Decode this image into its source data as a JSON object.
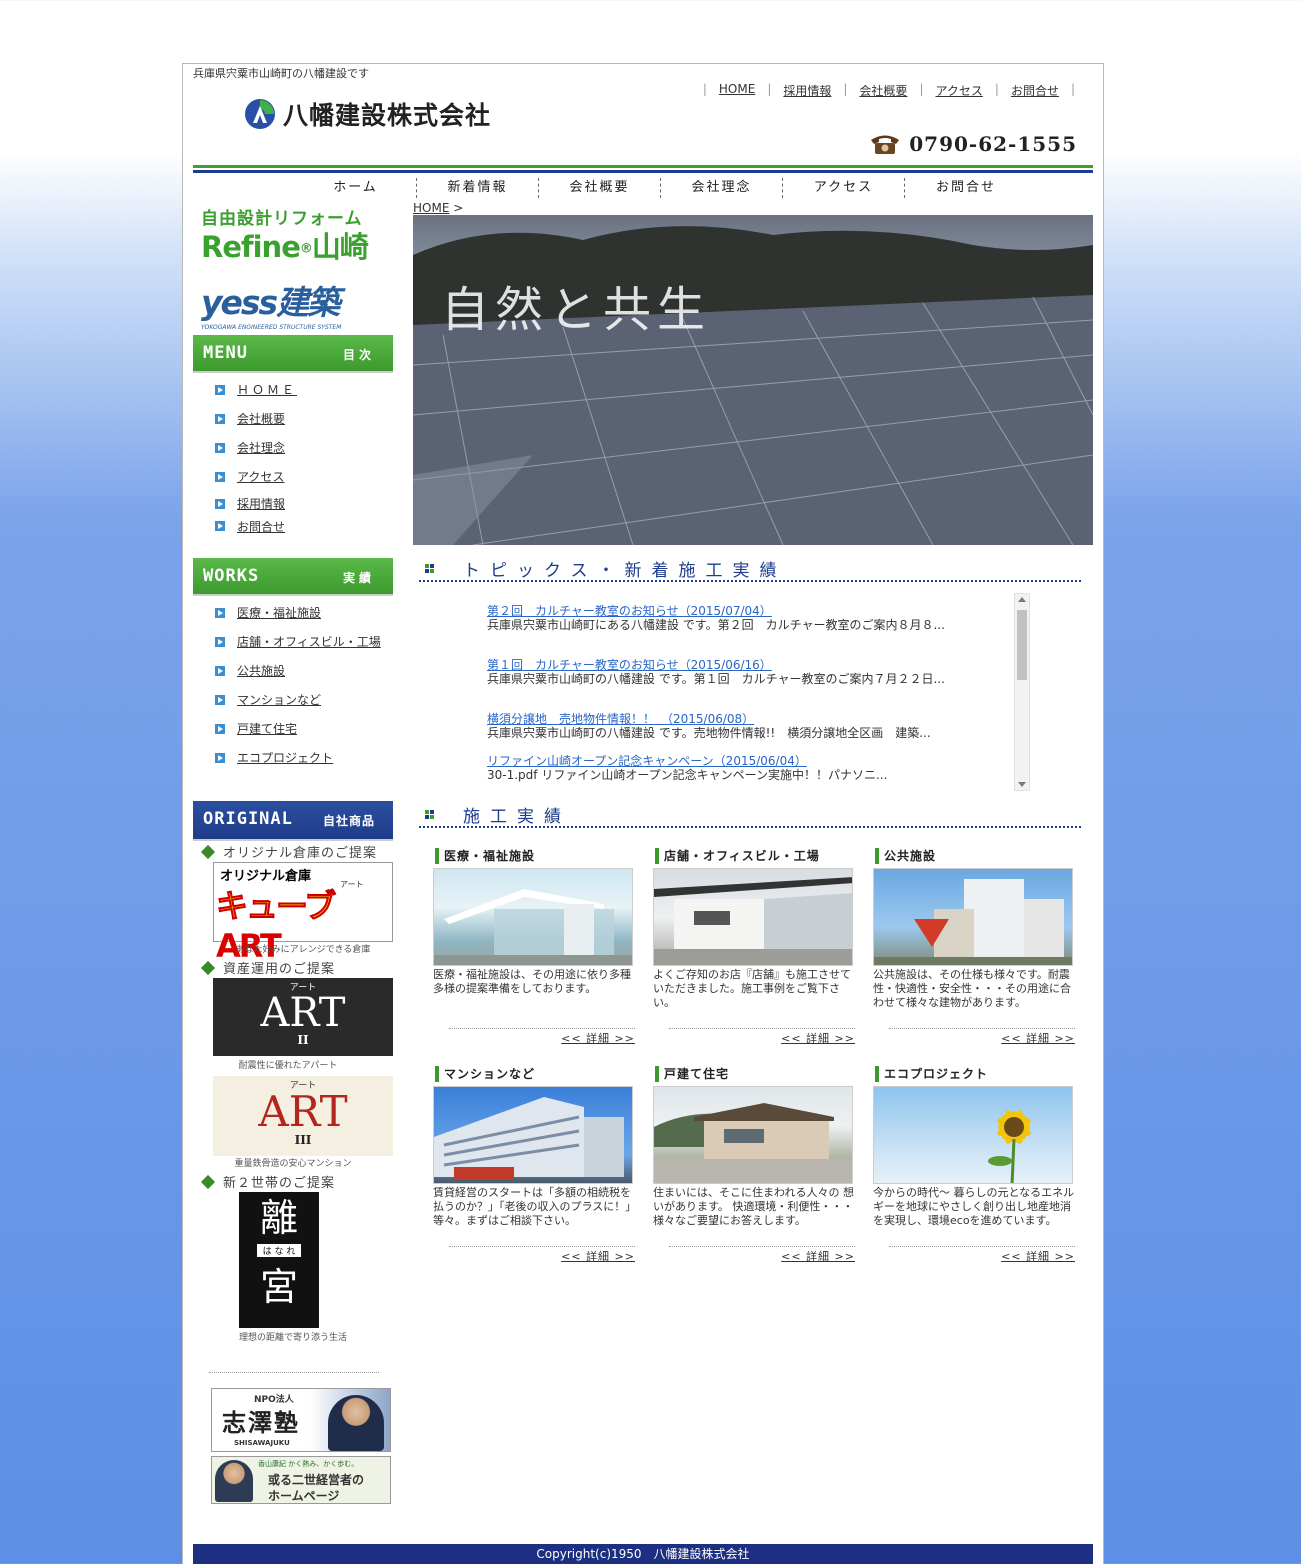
{
  "header": {
    "tagline": "兵庫県宍粟市山崎町の八幡建設です",
    "company_name": "八幡建設株式会社",
    "phone": "0790-62-1555",
    "top_links": [
      "HOME",
      "採用情報",
      "会社概要",
      "アクセス",
      "お問合せ"
    ]
  },
  "global_nav": [
    "ホーム",
    "新着情報",
    "会社概要",
    "会社理念",
    "アクセス",
    "お問合せ"
  ],
  "sidebar": {
    "refine_banner": {
      "line1": "自由設計リフォーム",
      "line2": "Refine",
      "line2b": "山崎"
    },
    "yess_banner": {
      "title": "yess建築",
      "sub": "YOKOGAWA ENGINEERED STRUCTURE SYSTEM"
    },
    "menu": {
      "title_en": "MENU",
      "title_jp": "目次",
      "items": [
        "ＨＯＭＥ",
        "会社概要",
        "会社理念",
        "アクセス",
        "採用情報",
        "お問合せ"
      ]
    },
    "works": {
      "title_en": "WORKS",
      "title_jp": "実績",
      "items": [
        "医療・福祉施設",
        "店舗・オフィスビル・工場",
        "公共施設",
        "マンションなど",
        "戸建て住宅",
        "エコプロジェクト"
      ]
    },
    "original": {
      "title_en": "ORIGINAL",
      "title_jp": "自社商品",
      "sec1": "オリジナル倉庫のご提案",
      "cube_line1": "オリジナル倉庫",
      "cube_line2": "キューブ",
      "cube_line3": "ART",
      "cube_ruby": "アート",
      "cube_cap": "あなた好みにアレンジできる倉庫",
      "sec2": "資産運用のご提案",
      "art2_ruby": "アート",
      "art2_title": "ART",
      "art2_num": "II",
      "art2_cap": "耐震性に優れたアパート",
      "art3_ruby": "アート",
      "art3_title": "ART",
      "art3_num": "III",
      "art3_cap": "重量鉄骨造の安心マンション",
      "sec3": "新２世帯のご提案",
      "rikyu_1": "離",
      "rikyu_ruby": "は な れ",
      "rikyu_2": "宮",
      "rikyu_cap": "理想の距離で寄り添う生活"
    },
    "bottom_banners": {
      "npo": "NPO法人",
      "juku": "志澤塾",
      "juku_en": "SHISAWAJUKU",
      "keiei_small": "香山康紀 かく熱み、かく歩む。",
      "keiei_1": "或る二世経営者の",
      "keiei_2": "ホームページ"
    }
  },
  "main": {
    "breadcrumb": "HOME",
    "breadcrumb_sep": " >",
    "hero_text": "自然と共生",
    "topics_heading": "トピックス・新着施工実績",
    "topics": [
      {
        "title": "第２回　カルチャー教室のお知らせ（2015/07/04）",
        "desc": "兵庫県宍粟市山崎町にある八幡建設 です。第２回　カルチャー教室のご案内８月８..."
      },
      {
        "title": "第１回　カルチャー教室のお知らせ（2015/06/16）",
        "desc": "兵庫県宍粟市山崎町の八幡建設 です。第１回　カルチャー教室のご案内７月２２日..."
      },
      {
        "title": "横須分譲地　売地物件情報！！　（2015/06/08）",
        "desc": "兵庫県宍粟市山崎町の八幡建設 です。売地物件情報!!　横須分譲地全区画　建築..."
      },
      {
        "title": "リファイン山崎オープン記念キャンペーン（2015/06/04）",
        "desc": "30-1.pdf リファイン山崎オープン記念キャンペーン実施中！！パナソニ..."
      }
    ],
    "works_heading": "施工実績",
    "more_label": "<< 詳細 >>",
    "works": [
      {
        "title": "医療・福祉施設",
        "desc": "医療・福祉施設は、その用途に依り多種多様の提案準備をしております。"
      },
      {
        "title": "店舗・オフィスビル・工場",
        "desc": "よくご存知のお店『店舗』も施工させていただきました。施工事例をご覧下さい。"
      },
      {
        "title": "公共施設",
        "desc": "公共施設は、その仕様も様々です。耐震性・快適性・安全性・・・その用途に合わせて様々な建物があります。"
      },
      {
        "title": "マンションなど",
        "desc": "賃貸経営のスタートは「多額の相続税を払うのか？」「老後の収入のプラスに！」等々。まずはご相談下さい。"
      },
      {
        "title": "戸建て住宅",
        "desc": "住まいには、そこに住まわれる人々の 想いがあります。 快適環境・利便性・・・ 様々なご要望にお答えします。"
      },
      {
        "title": "エコプロジェクト",
        "desc": "今からの時代〜 暮らしの元となるエネルギーを地球にやさしく創り出し地産地消を実現し、環境ecoを進めています。"
      }
    ]
  },
  "footer": {
    "copyright": "Copyright(c)1950　八幡建設株式会社"
  },
  "colors": {
    "green": "#3fa02a",
    "navy": "#1d3c8d",
    "link": "#2a66c8"
  }
}
